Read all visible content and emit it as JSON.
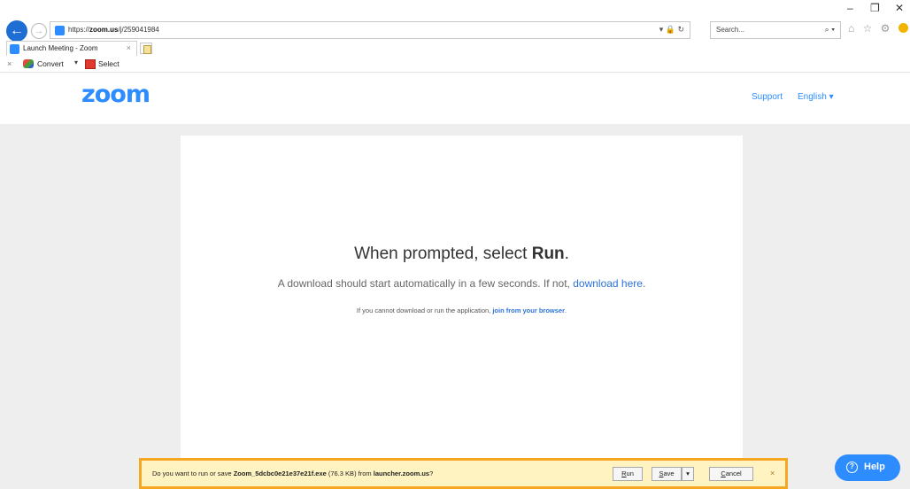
{
  "browser": {
    "url_prefix": "https://",
    "url_host": "zoom.us",
    "url_path": "/j/259041984",
    "addr_icons": "▾ 🔒 ↻",
    "search_placeholder": "Search...",
    "search_icon": "⌕ ▾",
    "right_icons": "⌂ ☆ ⚙",
    "minimize": "–",
    "restore": "❐",
    "close": "✕"
  },
  "tab": {
    "label": "Launch Meeting - Zoom",
    "close": "×"
  },
  "commandbar": {
    "close": "×",
    "convert_label": "Convert",
    "caret": "▾",
    "select_label": "Select"
  },
  "zoom": {
    "logo": "zoom",
    "support": "Support",
    "language": "English ▾"
  },
  "main": {
    "heading_prefix": "When prompted, select ",
    "heading_bold": "Run",
    "heading_suffix": ".",
    "download_text": "A download should start automatically in a few seconds. If not, ",
    "download_link": "download here",
    "download_suffix": ".",
    "browser_text": "If you cannot download or run the application, ",
    "browser_link": "join from your browser",
    "browser_suffix": "."
  },
  "notification": {
    "text_prefix": "Do you want to run or save ",
    "filename": "Zoom_5dcbc0e21e37e21f.exe",
    "size": " (76.3 KB) from ",
    "source": "launcher.zoom.us",
    "suffix": "?",
    "run_underline": "R",
    "run_rest": "un",
    "save_underline": "S",
    "save_rest": "ave",
    "save_caret": "▾",
    "cancel_underline": "C",
    "cancel_rest": "ancel",
    "close": "×"
  },
  "help": {
    "icon": "?",
    "label": "Help"
  },
  "colors": {
    "zoom_blue": "#2d8cff",
    "link_blue": "#2d72d9",
    "notification_border": "#f5a623",
    "notification_bg": "#fff3c2"
  }
}
